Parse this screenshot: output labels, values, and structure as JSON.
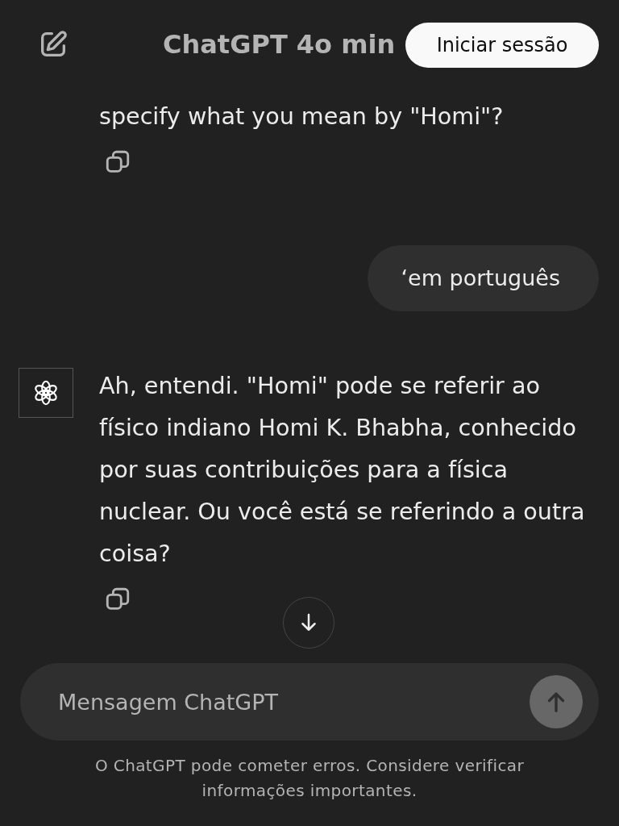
{
  "header": {
    "title": "ChatGPT 4o min",
    "login_button": "Iniciar sessão"
  },
  "messages": [
    {
      "kind": "assistant",
      "text": "specify what you mean by \"Homi\"?",
      "show_logo": false
    },
    {
      "kind": "user",
      "text": "‘em português"
    },
    {
      "kind": "assistant",
      "text": "Ah, entendi. \"Homi\" pode se referir ao físico indiano Homi K. Bhabha, conhecido por suas contribuições para a física nuclear. Ou você está se referindo a outra coisa?",
      "show_logo": true
    }
  ],
  "composer": {
    "placeholder": "Mensagem ChatGPT"
  },
  "disclaimer": "O ChatGPT pode cometer erros. Considere verificar informações importantes."
}
